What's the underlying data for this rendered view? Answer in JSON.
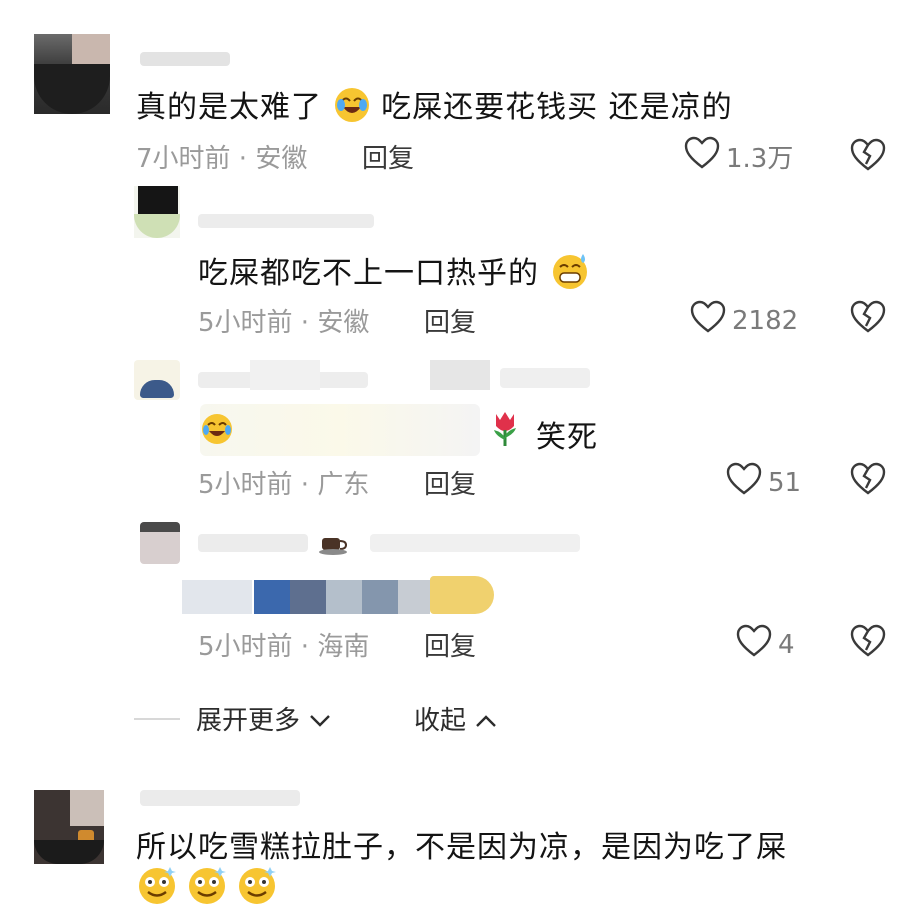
{
  "comments": [
    {
      "text_a": "真的是太难了",
      "text_b": "吃屎还要花钱买 还是凉的",
      "time": "7小时前",
      "location": "安徽",
      "reply_label": "回复",
      "likes": "1.3万"
    },
    {
      "text": "吃屎都吃不上一口热乎的",
      "time": "5小时前",
      "location": "安徽",
      "reply_label": "回复",
      "likes": "2182"
    },
    {
      "text": "笑死",
      "time": "5小时前",
      "location": "广东",
      "reply_label": "回复",
      "likes": "51"
    },
    {
      "time": "5小时前",
      "location": "海南",
      "reply_label": "回复",
      "likes": "4"
    },
    {
      "text": "所以吃雪糕拉肚子，不是因为凉，是因为吃了屎"
    }
  ],
  "thread_controls": {
    "expand_label": "展开更多",
    "collapse_label": "收起"
  },
  "icons": {
    "like": "heart-outline-icon",
    "dislike": "broken-heart-icon",
    "expand": "chevron-down-icon",
    "collapse": "chevron-up-icon"
  },
  "colors": {
    "text": "#141414",
    "meta": "#9a9a9a",
    "icon": "#3a3a3a"
  }
}
